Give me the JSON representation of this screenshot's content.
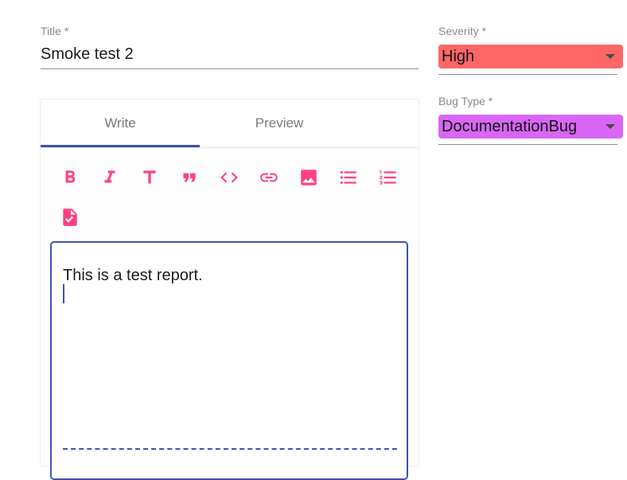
{
  "form": {
    "title_label": "Title *",
    "title_value": "Smoke test 2",
    "severity_label": "Severity *",
    "severity_value": "High",
    "bug_type_label": "Bug Type *",
    "bug_type_value": "DocumentationBug"
  },
  "editor": {
    "tabs": [
      {
        "label": "Write",
        "active": true
      },
      {
        "label": "Preview",
        "active": false
      }
    ],
    "toolbar": [
      "bold-icon",
      "italic-icon",
      "heading-icon",
      "quote-icon",
      "code-icon",
      "link-icon",
      "image-icon",
      "bulleted-list-icon",
      "numbered-list-icon",
      "checked-file-icon"
    ],
    "body_text": "This is a test report."
  },
  "colors": {
    "accent": "#3f51b5",
    "toolbar_icon": "#ff4081",
    "severity_bg": "#ff6666",
    "bug_type_bg": "#d966f5"
  }
}
